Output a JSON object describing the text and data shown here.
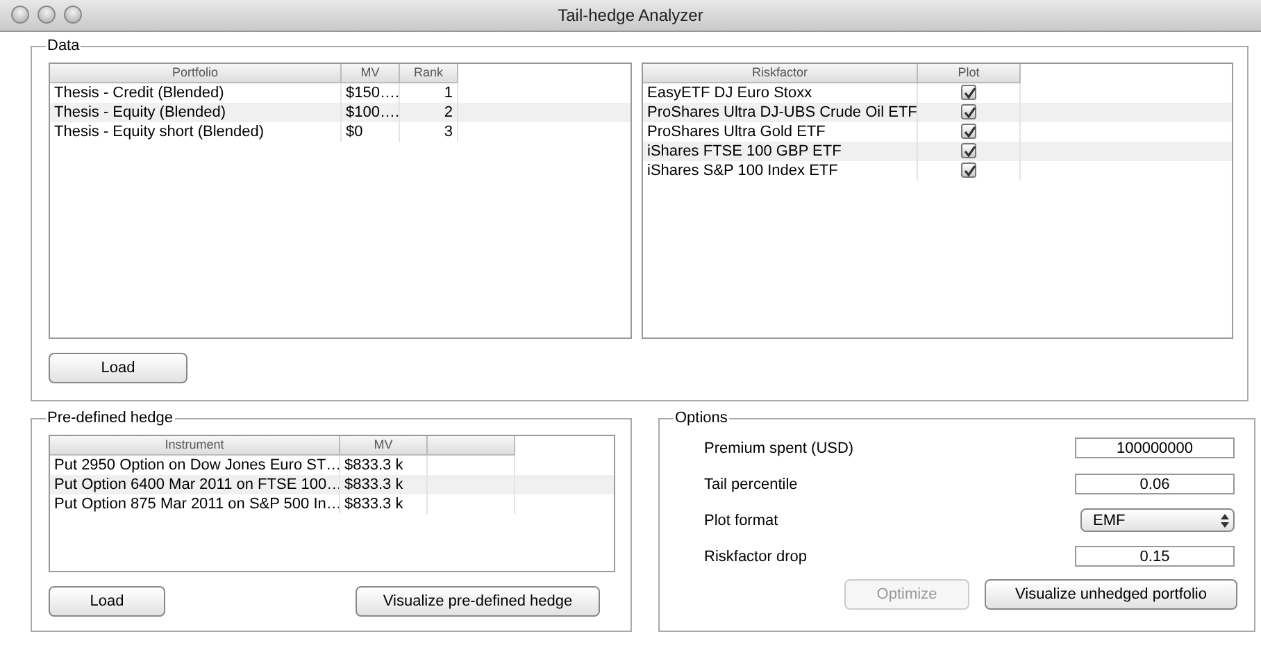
{
  "window": {
    "title": "Tail-hedge Analyzer"
  },
  "data": {
    "label": "Data",
    "portfolio_table": {
      "columns": [
        "Portfolio",
        "MV",
        "Rank"
      ],
      "rows": [
        [
          "Thesis - Credit (Blended)",
          "$150….",
          "1"
        ],
        [
          "Thesis - Equity (Blended)",
          "$100….",
          "2"
        ],
        [
          "Thesis - Equity short (Blended)",
          "$0",
          "3"
        ]
      ]
    },
    "riskfactor_table": {
      "columns": [
        "Riskfactor",
        "Plot"
      ],
      "rows": [
        {
          "name": "EasyETF DJ Euro Stoxx",
          "plot": true
        },
        {
          "name": "ProShares Ultra DJ-UBS Crude Oil ETF",
          "plot": true
        },
        {
          "name": "ProShares Ultra Gold ETF",
          "plot": true
        },
        {
          "name": "iShares FTSE 100 GBP ETF",
          "plot": true
        },
        {
          "name": "iShares S&P 100 Index ETF",
          "plot": true
        }
      ]
    },
    "load_button": "Load"
  },
  "hedge": {
    "label": "Pre-defined hedge",
    "table": {
      "columns": [
        "Instrument",
        "MV"
      ],
      "rows": [
        [
          "Put 2950 Option on Dow Jones Euro ST…",
          "$833.3 k"
        ],
        [
          "Put Option 6400 Mar 2011 on FTSE 100…",
          "$833.3 k"
        ],
        [
          "Put Option 875 Mar 2011 on S&P 500 In…",
          "$833.3 k"
        ]
      ]
    },
    "buttons": [
      {
        "label": "Load",
        "disabled": false
      },
      {
        "label": "Visualize pre-defined hedge",
        "disabled": false
      }
    ]
  },
  "options": {
    "label": "Options",
    "fields": [
      {
        "kind": "text",
        "label": "Premium spent (USD)",
        "value": "100000000"
      },
      {
        "kind": "text",
        "label": "Tail percentile",
        "value": "0.06"
      },
      {
        "kind": "select",
        "label": "Plot format",
        "value": "EMF"
      },
      {
        "kind": "text",
        "label": "Riskfactor drop",
        "value": "0.15"
      }
    ],
    "buttons": [
      {
        "label": "Optimize",
        "disabled": true
      },
      {
        "label": "Visualize unhedged portfolio",
        "disabled": false
      }
    ]
  }
}
